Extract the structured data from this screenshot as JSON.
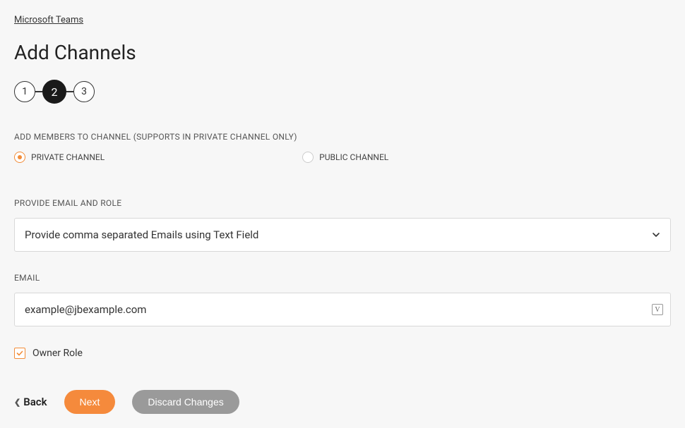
{
  "breadcrumb": "Microsoft Teams",
  "title": "Add Channels",
  "stepper": {
    "steps": [
      "1",
      "2",
      "3"
    ],
    "active": 2
  },
  "section_members_label": "ADD MEMBERS TO CHANNEL (SUPPORTS IN PRIVATE CHANNEL ONLY)",
  "radio": {
    "private": "PRIVATE CHANNEL",
    "public": "PUBLIC CHANNEL",
    "selected": "private"
  },
  "email_role_label": "PROVIDE EMAIL AND ROLE",
  "email_role_select_value": "Provide comma separated Emails using Text Field",
  "email_label": "EMAIL",
  "email_value": "example@jbexample.com",
  "owner_role_label": "Owner Role",
  "owner_role_checked": true,
  "buttons": {
    "back": "Back",
    "next": "Next",
    "discard": "Discard Changes"
  }
}
